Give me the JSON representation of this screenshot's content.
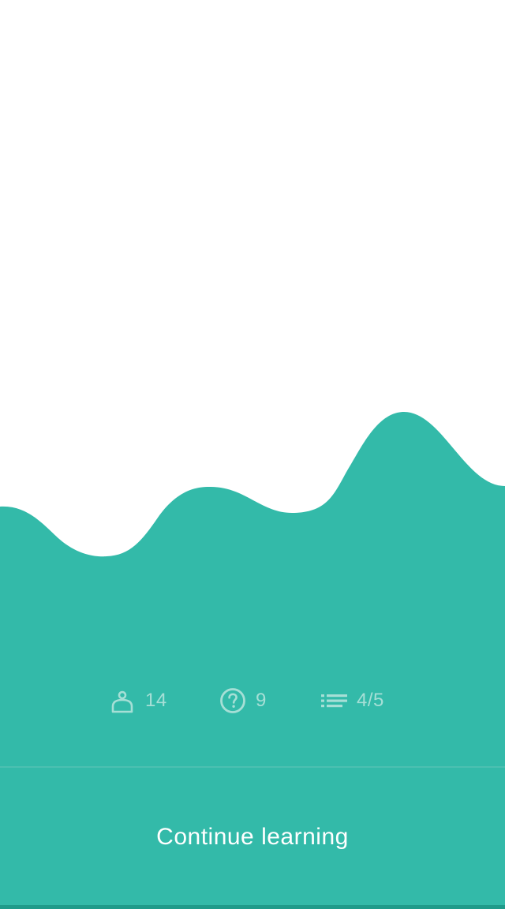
{
  "colors": {
    "background": "#ffffff",
    "accent": "#33baa9",
    "stat_muted": "#a6dfd6",
    "divider": "#4bc0b1",
    "bottom_bar": "#1f9b8a",
    "cta_text": "#ffffff"
  },
  "stats": [
    {
      "icon": "person-icon",
      "value": "14"
    },
    {
      "icon": "question-circle-icon",
      "value": "9"
    },
    {
      "icon": "list-icon",
      "value": "4/5"
    }
  ],
  "cta": {
    "label": "Continue learning"
  }
}
